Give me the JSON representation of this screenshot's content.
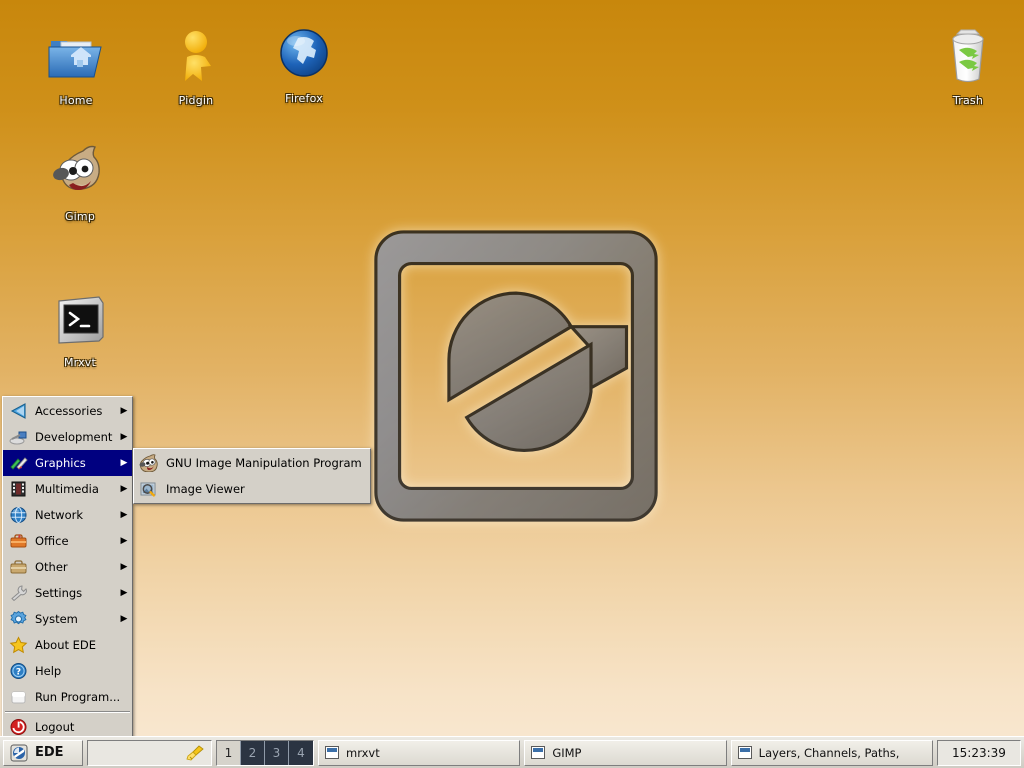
{
  "desktop": {
    "background_top_color": "#c8870c",
    "background_bottom_color": "#f9e9d4",
    "logo_name": "ede-logo-watermark",
    "icons": [
      {
        "label": "Home",
        "icon": "home-folder-icon"
      },
      {
        "label": "Pidgin",
        "icon": "pidgin-buddy-icon"
      },
      {
        "label": "Firefox",
        "icon": "firefox-globe-icon"
      },
      {
        "label": "Trash",
        "icon": "trash-can-icon"
      },
      {
        "label": "Gimp",
        "icon": "gimp-wilber-icon"
      },
      {
        "label": "Mrxvt",
        "icon": "terminal-icon"
      }
    ]
  },
  "start_menu": {
    "highlight_color": "#000080",
    "items": [
      {
        "label": "Accessories",
        "icon": "accessories-triangle-icon",
        "submenu": true
      },
      {
        "label": "Development",
        "icon": "development-tools-icon",
        "submenu": true
      },
      {
        "label": "Graphics",
        "icon": "graphics-pencil-icon",
        "submenu": true,
        "selected": true
      },
      {
        "label": "Multimedia",
        "icon": "multimedia-film-icon",
        "submenu": true
      },
      {
        "label": "Network",
        "icon": "network-globe-icon",
        "submenu": true
      },
      {
        "label": "Office",
        "icon": "office-briefcase-icon",
        "submenu": true
      },
      {
        "label": "Other",
        "icon": "other-briefcase-icon",
        "submenu": true
      },
      {
        "label": "Settings",
        "icon": "settings-wrench-icon",
        "submenu": true
      },
      {
        "label": "System",
        "icon": "system-gear-icon",
        "submenu": true
      },
      {
        "label": "About EDE",
        "icon": "about-star-icon",
        "submenu": false
      },
      {
        "label": "Help",
        "icon": "help-question-icon",
        "submenu": false
      },
      {
        "label": "Run Program...",
        "icon": "run-program-icon",
        "submenu": false
      },
      {
        "label": "Logout",
        "icon": "logout-power-icon",
        "submenu": false,
        "separator_before": true
      }
    ]
  },
  "sub_menu": {
    "parent": "Graphics",
    "items": [
      {
        "label": "GNU Image Manipulation Program",
        "icon": "gimp-wilber-icon"
      },
      {
        "label": "Image Viewer",
        "icon": "image-viewer-icon"
      }
    ]
  },
  "taskbar": {
    "start_button_label": "EDE",
    "start_button_icon": "ede-logo-icon",
    "tray_icon": "broom-icon",
    "workspaces": [
      {
        "label": "1",
        "active": true
      },
      {
        "label": "2",
        "active": false
      },
      {
        "label": "3",
        "active": false
      },
      {
        "label": "4",
        "active": false
      }
    ],
    "tasks": [
      {
        "label": "mrxvt"
      },
      {
        "label": "GIMP"
      },
      {
        "label": "Layers, Channels, Paths,"
      }
    ],
    "clock": "15:23:39"
  }
}
